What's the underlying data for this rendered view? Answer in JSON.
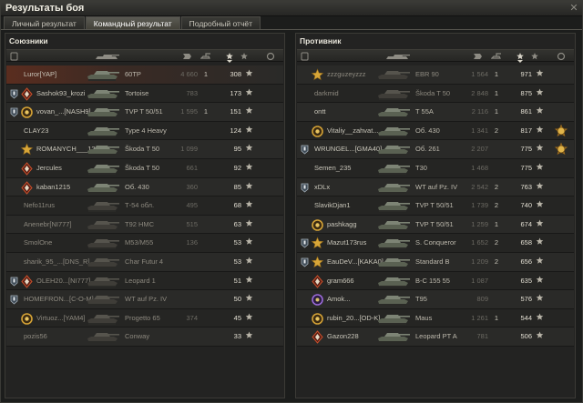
{
  "window": {
    "title": "Результаты боя",
    "close": "✕"
  },
  "tabs": [
    {
      "label": "Личный результат",
      "active": false
    },
    {
      "label": "Командный результат",
      "active": true
    },
    {
      "label": "Подробный отчёт",
      "active": false
    }
  ],
  "allies": {
    "title": "Союзники",
    "rows": [
      {
        "name": "Luror[YAP]",
        "vehicle": "60TP",
        "damage": "4 660",
        "frags": "1",
        "xp": "308",
        "self": true,
        "dead": false,
        "squad": false,
        "mark": "none",
        "medal": false
      },
      {
        "name": "Sashok93_krozi",
        "vehicle": "Tortoise",
        "damage": "783",
        "frags": "",
        "xp": "173",
        "self": false,
        "dead": false,
        "squad": true,
        "mark": "red-diamond",
        "medal": false
      },
      {
        "name": "vovan_...[NASH9]",
        "vehicle": "TVP T 50/51",
        "damage": "1 595",
        "frags": "1",
        "xp": "151",
        "self": false,
        "dead": false,
        "squad": true,
        "mark": "gold-ring",
        "medal": false
      },
      {
        "name": "CLAY23",
        "vehicle": "Type 4 Heavy",
        "damage": "",
        "frags": "",
        "xp": "124",
        "self": false,
        "dead": false,
        "squad": false,
        "mark": "none",
        "medal": false
      },
      {
        "name": "ROMANYCH___12",
        "vehicle": "Škoda T 50",
        "damage": "1 099",
        "frags": "",
        "xp": "95",
        "self": false,
        "dead": false,
        "squad": false,
        "mark": "gold-star",
        "medal": false
      },
      {
        "name": "Jercules",
        "vehicle": "Škoda T 50",
        "damage": "661",
        "frags": "",
        "xp": "92",
        "self": false,
        "dead": false,
        "squad": false,
        "mark": "red-diamond",
        "medal": false
      },
      {
        "name": "kaban1215",
        "vehicle": "Об. 430",
        "damage": "360",
        "frags": "",
        "xp": "85",
        "self": false,
        "dead": false,
        "squad": false,
        "mark": "red-diamond",
        "medal": false
      },
      {
        "name": "Nefo11rus",
        "vehicle": "Т-54 обл.",
        "damage": "495",
        "frags": "",
        "xp": "68",
        "self": false,
        "dead": true,
        "squad": false,
        "mark": "none",
        "medal": false
      },
      {
        "name": "Anenebr[NI777]",
        "vehicle": "T92 HMC",
        "damage": "515",
        "frags": "",
        "xp": "63",
        "self": false,
        "dead": true,
        "squad": false,
        "mark": "none",
        "medal": false
      },
      {
        "name": "SmolOne",
        "vehicle": "M53/M55",
        "damage": "136",
        "frags": "",
        "xp": "53",
        "self": false,
        "dead": true,
        "squad": false,
        "mark": "none",
        "medal": false
      },
      {
        "name": "sharik_95_...[DNS_R]",
        "vehicle": "Char Futur 4",
        "damage": "",
        "frags": "",
        "xp": "53",
        "self": false,
        "dead": true,
        "squad": false,
        "mark": "none",
        "medal": false
      },
      {
        "name": "OLEH20...[NI777]",
        "vehicle": "Leopard 1",
        "damage": "",
        "frags": "",
        "xp": "51",
        "self": false,
        "dead": true,
        "squad": true,
        "mark": "red-diamond",
        "medal": false
      },
      {
        "name": "HOMEFRON...[C-O-M]",
        "vehicle": "WT auf Pz. IV",
        "damage": "",
        "frags": "",
        "xp": "50",
        "self": false,
        "dead": true,
        "squad": true,
        "mark": "none",
        "medal": false
      },
      {
        "name": "Virtuoz...[YAM4]",
        "vehicle": "Progetto 65",
        "damage": "374",
        "frags": "",
        "xp": "45",
        "self": false,
        "dead": true,
        "squad": false,
        "mark": "gold-ring",
        "medal": false
      },
      {
        "name": "pozis56",
        "vehicle": "Conway",
        "damage": "",
        "frags": "",
        "xp": "33",
        "self": false,
        "dead": true,
        "squad": false,
        "mark": "none",
        "medal": false
      }
    ]
  },
  "enemies": {
    "title": "Противник",
    "rows": [
      {
        "name": "zzzguzeyzzz",
        "vehicle": "EBR 90",
        "damage": "1 564",
        "frags": "1",
        "xp": "971",
        "self": false,
        "dead": true,
        "squad": false,
        "mark": "gold-star",
        "medal": false
      },
      {
        "name": "darkmid",
        "vehicle": "Škoda T 50",
        "damage": "2 848",
        "frags": "1",
        "xp": "875",
        "self": false,
        "dead": true,
        "squad": false,
        "mark": "none",
        "medal": false
      },
      {
        "name": "ontt",
        "vehicle": "T 55A",
        "damage": "2 116",
        "frags": "1",
        "xp": "861",
        "self": false,
        "dead": false,
        "squad": false,
        "mark": "none",
        "medal": false
      },
      {
        "name": "Vitaliy__zahvat...",
        "vehicle": "Об. 430",
        "damage": "1 341",
        "frags": "2",
        "xp": "817",
        "self": false,
        "dead": false,
        "squad": false,
        "mark": "gold-ring",
        "medal": true
      },
      {
        "name": "WRUNGEL...[GMA40]",
        "vehicle": "Об. 261",
        "damage": "2 207",
        "frags": "",
        "xp": "775",
        "self": false,
        "dead": false,
        "squad": true,
        "mark": "none",
        "medal": true
      },
      {
        "name": "Semen_235",
        "vehicle": "T30",
        "damage": "1 468",
        "frags": "",
        "xp": "775",
        "self": false,
        "dead": false,
        "squad": false,
        "mark": "none",
        "medal": false
      },
      {
        "name": "xDLx",
        "vehicle": "WT auf Pz. IV",
        "damage": "2 542",
        "frags": "2",
        "xp": "763",
        "self": false,
        "dead": false,
        "squad": true,
        "mark": "none",
        "medal": false
      },
      {
        "name": "SlavikDjan1",
        "vehicle": "TVP T 50/51",
        "damage": "1 739",
        "frags": "2",
        "xp": "740",
        "self": false,
        "dead": false,
        "squad": false,
        "mark": "none",
        "medal": false
      },
      {
        "name": "pashkagg",
        "vehicle": "TVP T 50/51",
        "damage": "1 259",
        "frags": "1",
        "xp": "674",
        "self": false,
        "dead": false,
        "squad": false,
        "mark": "gold-ring",
        "medal": false
      },
      {
        "name": "Mazut173rus",
        "vehicle": "S. Conqueror",
        "damage": "1 652",
        "frags": "2",
        "xp": "658",
        "self": false,
        "dead": false,
        "squad": true,
        "mark": "gold-star",
        "medal": false
      },
      {
        "name": "EauDeV...[KAKA0]",
        "vehicle": "Standard B",
        "damage": "1 209",
        "frags": "2",
        "xp": "656",
        "self": false,
        "dead": false,
        "squad": true,
        "mark": "gold-star",
        "medal": false
      },
      {
        "name": "gram666",
        "vehicle": "B-C 155 55",
        "damage": "1 087",
        "frags": "",
        "xp": "635",
        "self": false,
        "dead": false,
        "squad": false,
        "mark": "red-diamond",
        "medal": false
      },
      {
        "name": "Amok...",
        "vehicle": "T95",
        "damage": "809",
        "frags": "",
        "xp": "576",
        "self": false,
        "dead": false,
        "squad": false,
        "mark": "purple-ring",
        "medal": false
      },
      {
        "name": "rubin_20...[OD-K]",
        "vehicle": "Maus",
        "damage": "1 261",
        "frags": "1",
        "xp": "544",
        "self": false,
        "dead": false,
        "squad": false,
        "mark": "gold-ring",
        "medal": false
      },
      {
        "name": "Gazon228",
        "vehicle": "Leopard PT A",
        "damage": "781",
        "frags": "",
        "xp": "506",
        "self": false,
        "dead": false,
        "squad": false,
        "mark": "red-diamond",
        "medal": false
      }
    ]
  },
  "colors": {
    "accent": "#f0c040",
    "self_row": "#5a2d1f",
    "text": "#c9c6bc",
    "dead_text": "#8d897f"
  }
}
